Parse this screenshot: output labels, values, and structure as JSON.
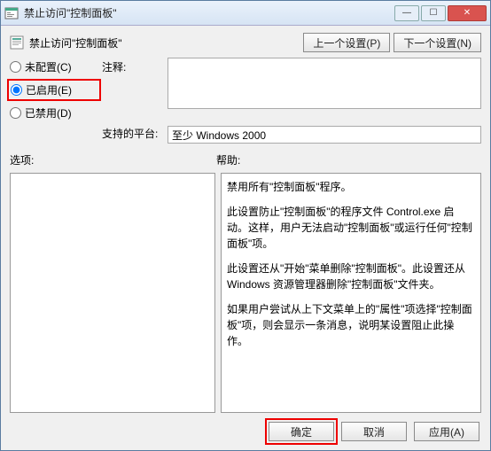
{
  "window": {
    "title": "禁止访问\"控制面板\""
  },
  "header": {
    "subtitle": "禁止访问\"控制面板\"",
    "prev": "上一个设置(P)",
    "next": "下一个设置(N)"
  },
  "radios": {
    "not_configured": "未配置(C)",
    "enabled": "已启用(E)",
    "disabled": "已禁用(D)",
    "selected": "enabled"
  },
  "labels": {
    "comment": "注释:",
    "platform": "支持的平台:",
    "options": "选项:",
    "help": "帮助:"
  },
  "fields": {
    "comment_value": "",
    "platform_value": "至少 Windows 2000"
  },
  "help": {
    "p1": "禁用所有\"控制面板\"程序。",
    "p2": "此设置防止\"控制面板\"的程序文件 Control.exe 启动。这样，用户无法启动\"控制面板\"或运行任何\"控制面板\"项。",
    "p3": "此设置还从\"开始\"菜单删除\"控制面板\"。此设置还从 Windows 资源管理器删除\"控制面板\"文件夹。",
    "p4": "如果用户尝试从上下文菜单上的\"属性\"项选择\"控制面板\"项，则会显示一条消息，说明某设置阻止此操作。"
  },
  "buttons": {
    "ok": "确定",
    "cancel": "取消",
    "apply": "应用(A)"
  }
}
